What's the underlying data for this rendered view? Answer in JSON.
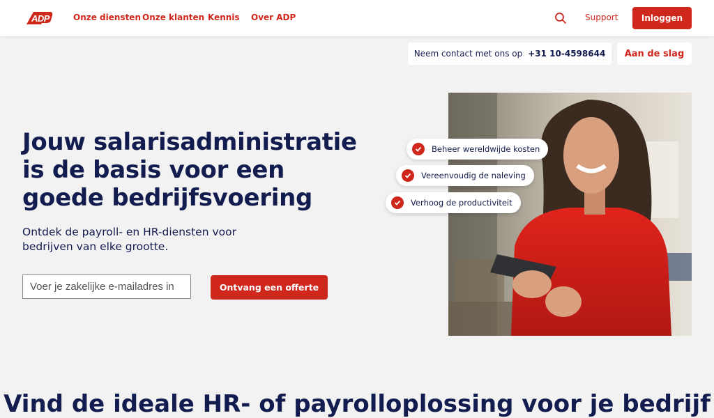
{
  "brand": {
    "name": "ADP",
    "color": "#d0271d",
    "navy": "#121c4e"
  },
  "nav": {
    "links": [
      "Onze diensten",
      "Onze klanten",
      "Kennis",
      "Over ADP"
    ],
    "support": "Support",
    "login": "Inloggen"
  },
  "contact": {
    "label": "Neem contact met ons op",
    "phone": "+31 10-4598644",
    "start": "Aan de slag"
  },
  "hero": {
    "title": "Jouw salarisadministratie is de basis voor een goede bedrijfsvoering",
    "subtitle": "Ontdek de payroll- en HR-diensten voor bedrijven van elke grootte.",
    "email_placeholder": "Voer je zakelijke e-mailadres in",
    "cta": "Ontvang een offerte",
    "chips": [
      "Beheer wereldwijde kosten",
      "Vereenvoudig de naleving",
      "Verhoog de productiviteit"
    ]
  },
  "section": {
    "title": "Vind de ideale HR- of payrolloplossing voor je bedrijf"
  }
}
